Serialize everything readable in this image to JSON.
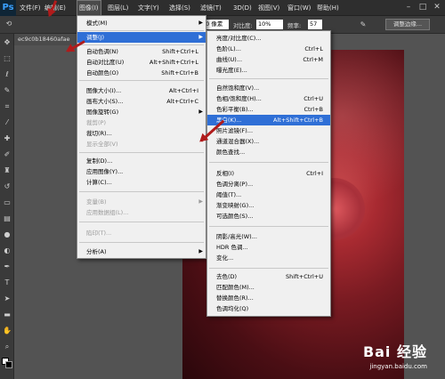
{
  "app": {
    "logo": "Ps"
  },
  "menubar": {
    "items": [
      "文件(F)",
      "编辑(E)",
      "图像(I)",
      "图层(L)",
      "文字(Y)",
      "选择(S)",
      "滤镜(T)",
      "3D(D)",
      "视图(V)",
      "窗口(W)",
      "帮助(H)"
    ],
    "active": "图像(I)"
  },
  "optionsbar": {
    "size_label": "像素",
    "size_value": "10 像素",
    "contrast_label": "对比度:",
    "contrast_value": "10%",
    "frequency_label": "频率:",
    "frequency_value": "57",
    "adjust_edge_button": "调整边缘..."
  },
  "document": {
    "tab_title": "ec9c0b18460afae"
  },
  "image_menu": {
    "items": [
      {
        "label": "模式(M)",
        "shortcut": "",
        "submenu": true,
        "disabled": false
      },
      {
        "label": "调整(J)",
        "shortcut": "",
        "submenu": true,
        "disabled": false,
        "highlighted": true
      },
      {
        "label": "自动色调(N)",
        "shortcut": "Shift+Ctrl+L",
        "submenu": false,
        "disabled": false
      },
      {
        "label": "自动对比度(U)",
        "shortcut": "Alt+Shift+Ctrl+L",
        "submenu": false,
        "disabled": false
      },
      {
        "label": "自动颜色(O)",
        "shortcut": "Shift+Ctrl+B",
        "submenu": false,
        "disabled": false
      },
      {
        "label": "图像大小(I)...",
        "shortcut": "Alt+Ctrl+I",
        "submenu": false,
        "disabled": false
      },
      {
        "label": "画布大小(S)...",
        "shortcut": "Alt+Ctrl+C",
        "submenu": false,
        "disabled": false
      },
      {
        "label": "图像旋转(G)",
        "shortcut": "",
        "submenu": true,
        "disabled": false
      },
      {
        "label": "裁剪(P)",
        "shortcut": "",
        "submenu": false,
        "disabled": true
      },
      {
        "label": "裁切(R)...",
        "shortcut": "",
        "submenu": false,
        "disabled": false
      },
      {
        "label": "显示全部(V)",
        "shortcut": "",
        "submenu": false,
        "disabled": true
      },
      {
        "label": "复制(D)...",
        "shortcut": "",
        "submenu": false,
        "disabled": false
      },
      {
        "label": "应用图像(Y)...",
        "shortcut": "",
        "submenu": false,
        "disabled": false
      },
      {
        "label": "计算(C)...",
        "shortcut": "",
        "submenu": false,
        "disabled": false
      },
      {
        "label": "变量(B)",
        "shortcut": "",
        "submenu": true,
        "disabled": true
      },
      {
        "label": "应用数据组(L)...",
        "shortcut": "",
        "submenu": false,
        "disabled": true
      },
      {
        "label": "陷印(T)...",
        "shortcut": "",
        "submenu": false,
        "disabled": true
      },
      {
        "label": "分析(A)",
        "shortcut": "",
        "submenu": true,
        "disabled": false
      }
    ]
  },
  "adjust_menu": {
    "items": [
      {
        "label": "亮度/对比度(C)...",
        "shortcut": ""
      },
      {
        "label": "色阶(L)...",
        "shortcut": "Ctrl+L"
      },
      {
        "label": "曲线(U)...",
        "shortcut": "Ctrl+M"
      },
      {
        "label": "曝光度(E)...",
        "shortcut": ""
      },
      {
        "label": "自然饱和度(V)...",
        "shortcut": ""
      },
      {
        "label": "色相/饱和度(H)...",
        "shortcut": "Ctrl+U"
      },
      {
        "label": "色彩平衡(B)...",
        "shortcut": "Ctrl+B"
      },
      {
        "label": "黑白(K)...",
        "shortcut": "Alt+Shift+Ctrl+B",
        "highlighted": true
      },
      {
        "label": "照片滤镜(F)...",
        "shortcut": ""
      },
      {
        "label": "通道混合器(X)...",
        "shortcut": ""
      },
      {
        "label": "颜色查找...",
        "shortcut": ""
      },
      {
        "label": "反相(I)",
        "shortcut": "Ctrl+I"
      },
      {
        "label": "色调分离(P)...",
        "shortcut": ""
      },
      {
        "label": "阈值(T)...",
        "shortcut": ""
      },
      {
        "label": "渐变映射(G)...",
        "shortcut": ""
      },
      {
        "label": "可选颜色(S)...",
        "shortcut": ""
      },
      {
        "label": "阴影/高光(W)...",
        "shortcut": ""
      },
      {
        "label": "HDR 色调...",
        "shortcut": ""
      },
      {
        "label": "变化...",
        "shortcut": ""
      },
      {
        "label": "去色(D)",
        "shortcut": "Shift+Ctrl+U"
      },
      {
        "label": "匹配颜色(M)...",
        "shortcut": ""
      },
      {
        "label": "替换颜色(R)...",
        "shortcut": ""
      },
      {
        "label": "色调均化(Q)",
        "shortcut": ""
      }
    ]
  },
  "watermark": {
    "brand": "Bai 经验",
    "url": "jingyan.baidu.com"
  },
  "icons": {
    "toolbox": [
      "move-icon",
      "marquee-icon",
      "lasso-icon",
      "quick-select-icon",
      "crop-icon",
      "eyedropper-icon",
      "healing-icon",
      "brush-icon",
      "clone-stamp-icon",
      "history-brush-icon",
      "eraser-icon",
      "gradient-icon",
      "blur-icon",
      "dodge-icon",
      "pen-icon",
      "type-icon",
      "path-select-icon",
      "shape-icon",
      "hand-icon",
      "zoom-icon"
    ]
  },
  "colors": {
    "highlight": "#2f6fd6",
    "annotation_arrow": "#b01b1b"
  }
}
